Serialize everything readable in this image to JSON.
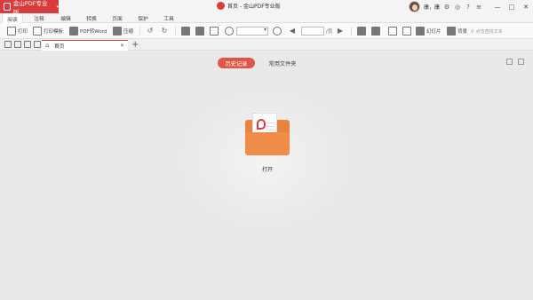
{
  "app": {
    "product_button": "金山PDF专业版",
    "window_title": "首页 - 金山PDF专业版",
    "user_name": "康，康"
  },
  "menu": {
    "tabs": [
      "阅读",
      "注释",
      "编辑",
      "转换",
      "页面",
      "保护",
      "工具"
    ],
    "active_index": 0
  },
  "toolbar": {
    "print": "打印",
    "print_template": "打印模板",
    "pdf_to_word": "PDF转Word",
    "compress": "压缩",
    "page_suffix": "/页",
    "fit": "幻灯片",
    "background": "背景",
    "search_placeholder": "点击查找文本"
  },
  "tabs": {
    "doc_tab_label": "首页"
  },
  "home": {
    "history_label": "历史记录",
    "folders_label": "常用文件夹",
    "open_label": "打开"
  },
  "colors": {
    "accent": "#d83c3c",
    "folder": "#f28c49"
  }
}
